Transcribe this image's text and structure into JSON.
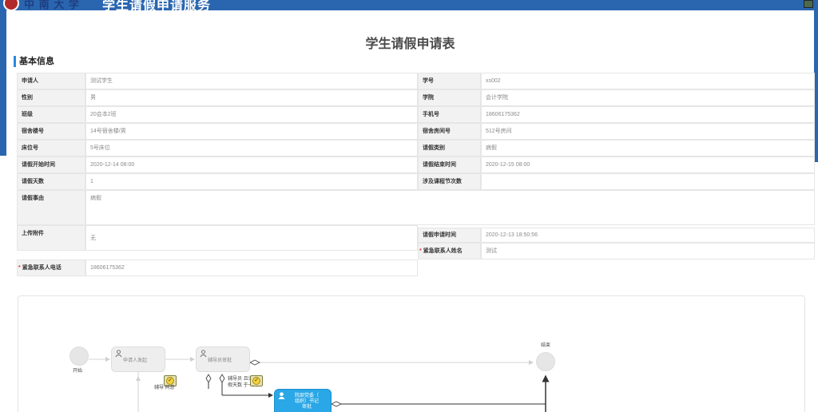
{
  "app": {
    "title": "学生请假申请服务"
  },
  "form": {
    "title": "学生请假申请表",
    "section": "基本信息",
    "rows": [
      {
        "l1": "申请人",
        "v1": "测试学生",
        "l2": "学号",
        "v2": "xs002"
      },
      {
        "l1": "性别",
        "v1": "男",
        "l2": "学院",
        "v2": "会计学院"
      },
      {
        "l1": "班级",
        "v1": "20会本2班",
        "l2": "手机号",
        "v2": "18606175362"
      },
      {
        "l1": "宿舍楼号",
        "v1": "14号宿舍楼/男",
        "l2": "宿舍房间号",
        "v2": "512号房间"
      },
      {
        "l1": "床位号",
        "v1": "5号床位",
        "l2": "请假类别",
        "v2": "病假"
      },
      {
        "l1": "请假开始时间",
        "v1": "2020-12-14 08:00",
        "l2": "请假结束时间",
        "v2": "2020-12-15 08:00"
      },
      {
        "l1": "请假天数",
        "v1": "1",
        "l2": "涉及课程节次数",
        "v2": ""
      }
    ],
    "reason": {
      "label": "请假事由",
      "value": "病假"
    },
    "attachment": {
      "label": "上传附件",
      "value": "无"
    },
    "apply_time": {
      "label": "请假申请时间",
      "value": "2020-12-13 18:50:56"
    },
    "emergency_name": {
      "label": "紧急联系人姓名",
      "value": "测试"
    },
    "emergency_phone": {
      "label": "紧急联系人电话",
      "value": "18606175362"
    },
    "required_mark": "*"
  },
  "flow": {
    "start": "开始",
    "end": "结束",
    "node_apply": "申请人发起",
    "node_counselor": "辅导员审批",
    "node_college": "院部党委（\n组织）书记\n审批",
    "cond1": "辅导 同意",
    "cond2a": "辅导员 且请",
    "cond2b": "假天数 于一天"
  },
  "colors": {
    "header": "#2a66b0",
    "accent": "#2a8be0",
    "active_node": "#2aa7e6"
  }
}
